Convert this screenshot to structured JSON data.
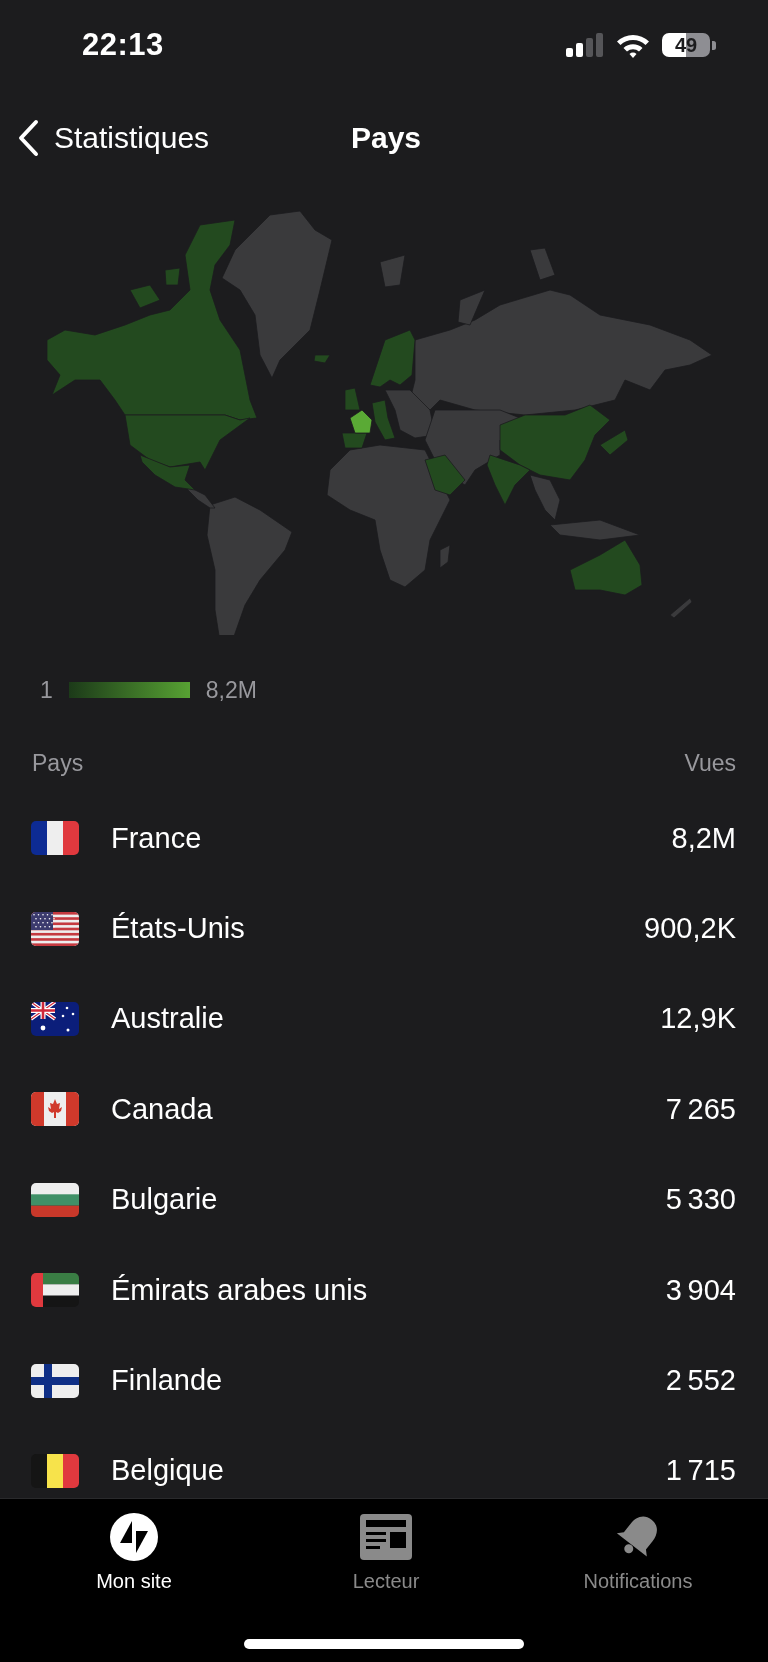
{
  "status_bar": {
    "time": "22:13",
    "battery": "49"
  },
  "nav": {
    "back_label": "Statistiques",
    "title": "Pays"
  },
  "map_legend": {
    "min": "1",
    "max": "8,2M"
  },
  "table": {
    "columns": [
      "Pays",
      "Vues"
    ],
    "rows": [
      {
        "kind": "fr",
        "country": "France",
        "views": "8,2M"
      },
      {
        "kind": "us",
        "country": "États-Unis",
        "views": "900,2K"
      },
      {
        "kind": "au",
        "country": "Australie",
        "views": "12,9K"
      },
      {
        "kind": "ca",
        "country": "Canada",
        "views": "7 265"
      },
      {
        "kind": "bg",
        "country": "Bulgarie",
        "views": "5 330"
      },
      {
        "kind": "ae",
        "country": "Émirats arabes unis",
        "views": "3 904"
      },
      {
        "kind": "fi",
        "country": "Finlande",
        "views": "2 552"
      },
      {
        "kind": "be",
        "country": "Belgique",
        "views": "1 715"
      }
    ]
  },
  "tab_bar": {
    "tabs": [
      {
        "kind": "site",
        "label": "Mon site",
        "selected": true
      },
      {
        "kind": "reader",
        "label": "Lecteur",
        "selected": false
      },
      {
        "kind": "notifications",
        "label": "Notifications",
        "selected": false
      }
    ]
  }
}
